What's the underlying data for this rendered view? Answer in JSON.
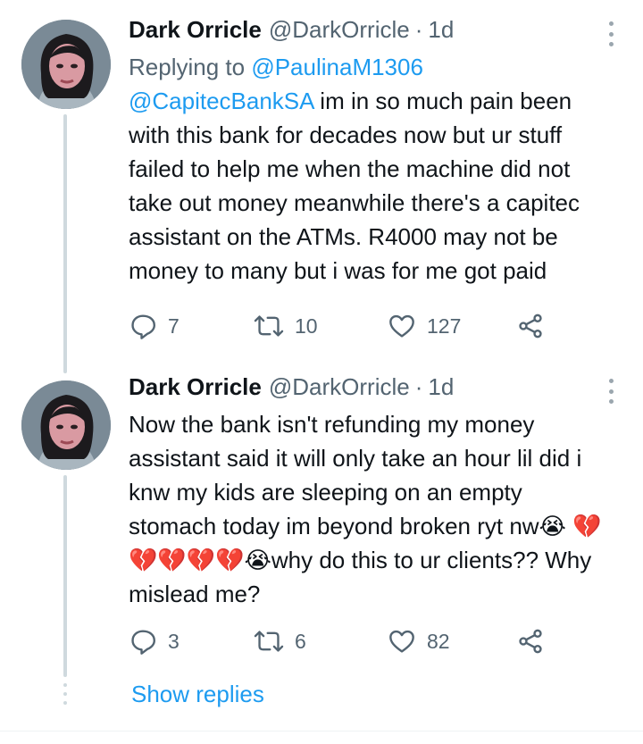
{
  "tweets": [
    {
      "author": "Dark Orricle",
      "handle": "@DarkOrricle",
      "separator": "·",
      "time": "1d",
      "replying_prefix": "Replying to ",
      "replying_to": "@PaulinaM1306",
      "mention": "@CapitecBankSA",
      "text": " im in so much pain been with this bank for decades now but ur stuff failed to help me when the machine did not take out money meanwhile there's a capitec assistant on the ATMs. R4000 may not be money to many but i was for me got paid",
      "replies": "7",
      "retweets": "10",
      "likes": "127"
    },
    {
      "author": "Dark Orricle",
      "handle": "@DarkOrricle",
      "separator": "·",
      "time": "1d",
      "text_1": "Now the bank isn't refunding my money assistant said it will only take an hour lil did i knw my kids are sleeping on an empty stomach today im beyond broken ryt nw😭",
      "text_2": "💔💔💔💔💔😭why do this to ur clients?? Why mislead me?",
      "replies": "3",
      "retweets": "6",
      "likes": "82"
    }
  ],
  "show_replies_label": "Show replies",
  "colors": {
    "accent": "#1d9bf0",
    "secondary_text": "#536471",
    "primary_text": "#0f1419",
    "thread_line": "#cfd9de"
  },
  "icons": [
    "avatar",
    "more-icon",
    "reply-icon",
    "retweet-icon",
    "like-icon",
    "share-icon"
  ]
}
